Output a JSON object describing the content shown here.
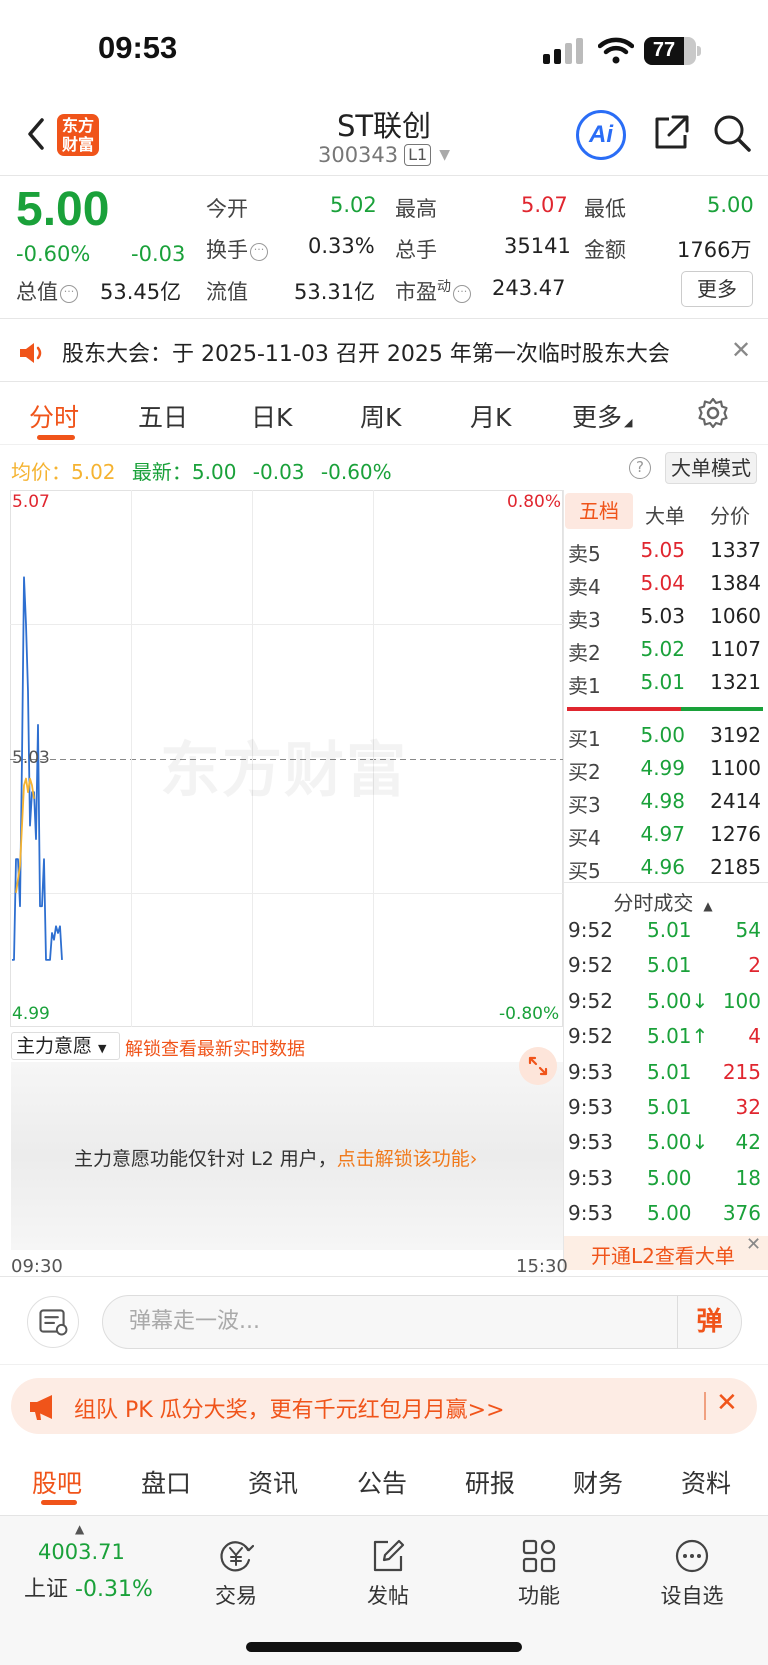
{
  "status": {
    "time": "09:53",
    "battery": "77",
    "battery_level": 0.77
  },
  "header": {
    "logo": "东方财富",
    "stock_name": "ST联创",
    "stock_code": "300343",
    "level": "L1",
    "ai_label": "Ai"
  },
  "quote": {
    "price": "5.00",
    "change_pct": "-0.60%",
    "change": "-0.03",
    "fields": {
      "open_label": "今开",
      "open": "5.02",
      "high_label": "最高",
      "high": "5.07",
      "low_label": "最低",
      "low": "5.00",
      "turnover_label": "换手",
      "turnover": "0.33%",
      "volume_label": "总手",
      "volume": "35141",
      "amount_label": "金额",
      "amount": "1766万",
      "mktcap_label": "总值",
      "mktcap": "53.45亿",
      "float_label": "流值",
      "float": "53.31亿",
      "pe_label": "市盈",
      "pe_sup": "动",
      "pe": "243.47"
    },
    "more_label": "更多"
  },
  "notice": {
    "text": "股东大会：于 2025-11-03 召开 2025 年第一次临时股东大会"
  },
  "chart_tabs": [
    "分时",
    "五日",
    "日K",
    "周K",
    "月K",
    "更多"
  ],
  "avg_row": {
    "avg_label": "均价：",
    "avg": "5.02",
    "latest_label": "最新：",
    "latest": "5.00",
    "change": "-0.03",
    "change_pct": "-0.60%"
  },
  "big_mode_label": "大单模式",
  "chart_data": {
    "type": "line",
    "y_top": "5.07",
    "y_bottom": "4.99",
    "y_mid": "5.03",
    "pct_top": "0.80%",
    "pct_bottom": "-0.80%",
    "ylim": [
      4.99,
      5.07
    ],
    "x_start": "09:30",
    "x_end": "15:30",
    "watermark": "东方财富",
    "series": [
      {
        "values": [
          5.0,
          5.0,
          5.015,
          5.015,
          5.008,
          5.03,
          5.057,
          5.05,
          5.04,
          5.02,
          5.025,
          5.025,
          5.018,
          5.035,
          5.008,
          5.008,
          5.015,
          5.0,
          5.0,
          5.0,
          5.004,
          5.003,
          5.005,
          5.004,
          5.005,
          5.0
        ]
      },
      {
        "values": [
          5.01,
          5.012,
          5.014,
          5.02,
          5.026,
          5.027,
          5.025,
          5.027,
          5.026,
          5.024
        ]
      }
    ]
  },
  "order_book": {
    "tabs": [
      "五档",
      "大单",
      "分价"
    ],
    "asks": [
      {
        "label": "卖5",
        "price": "5.05",
        "vol": "1337",
        "color": "#e0262f"
      },
      {
        "label": "卖4",
        "price": "5.04",
        "vol": "1384",
        "color": "#e0262f"
      },
      {
        "label": "卖3",
        "price": "5.03",
        "vol": "1060",
        "color": "#222222"
      },
      {
        "label": "卖2",
        "price": "5.02",
        "vol": "1107",
        "color": "#1aa13a"
      },
      {
        "label": "卖1",
        "price": "5.01",
        "vol": "1321",
        "color": "#1aa13a"
      }
    ],
    "bids": [
      {
        "label": "买1",
        "price": "5.00",
        "vol": "3192",
        "color": "#1aa13a"
      },
      {
        "label": "买2",
        "price": "4.99",
        "vol": "1100",
        "color": "#1aa13a"
      },
      {
        "label": "买3",
        "price": "4.98",
        "vol": "2414",
        "color": "#1aa13a"
      },
      {
        "label": "买4",
        "price": "4.97",
        "vol": "1276",
        "color": "#1aa13a"
      },
      {
        "label": "买5",
        "price": "4.96",
        "vol": "2185",
        "color": "#1aa13a"
      }
    ],
    "sell_ratio": 0.58
  },
  "ticks": {
    "title": "分时成交",
    "rows": [
      {
        "time": "9:52",
        "price": "5.01",
        "vol": "54",
        "vcolor": "#1aa13a"
      },
      {
        "time": "9:52",
        "price": "5.01",
        "vol": "2",
        "vcolor": "#e0262f"
      },
      {
        "time": "9:52",
        "price": "5.00↓",
        "vol": "100",
        "vcolor": "#1aa13a"
      },
      {
        "time": "9:52",
        "price": "5.01↑",
        "vol": "4",
        "vcolor": "#e0262f"
      },
      {
        "time": "9:53",
        "price": "5.01",
        "vol": "215",
        "vcolor": "#e0262f"
      },
      {
        "time": "9:53",
        "price": "5.01",
        "vol": "32",
        "vcolor": "#e0262f"
      },
      {
        "time": "9:53",
        "price": "5.00↓",
        "vol": "42",
        "vcolor": "#1aa13a"
      },
      {
        "time": "9:53",
        "price": "5.00",
        "vol": "18",
        "vcolor": "#1aa13a"
      },
      {
        "time": "9:53",
        "price": "5.00",
        "vol": "376",
        "vcolor": "#1aa13a"
      }
    ],
    "l2_banner": "开通L2查看大单"
  },
  "main_force": {
    "select_label": "主力意愿",
    "unlock_text": "解锁查看最新实时数据",
    "panel_text": "主力意愿功能仅针对 L2 用户，",
    "panel_link": "点击解锁该功能"
  },
  "comment": {
    "placeholder": "弹幕走一波...",
    "danmu_label": "弹"
  },
  "promo": {
    "text": "组队 PK 瓜分大奖，更有千元红包月月赢>>"
  },
  "bottom_tabs": [
    "股吧",
    "盘口",
    "资讯",
    "公告",
    "研报",
    "财务",
    "资料"
  ],
  "bottom_nav": {
    "index_value": "4003.71",
    "index_name": "上证",
    "index_change": "-0.31%",
    "items": [
      "交易",
      "发帖",
      "功能",
      "设自选"
    ]
  },
  "colors": {
    "up": "#e0262f",
    "down": "#1aa13a",
    "accent": "#f0541a",
    "price_line": "#2e6fd0",
    "avg_line": "#f5b331"
  }
}
